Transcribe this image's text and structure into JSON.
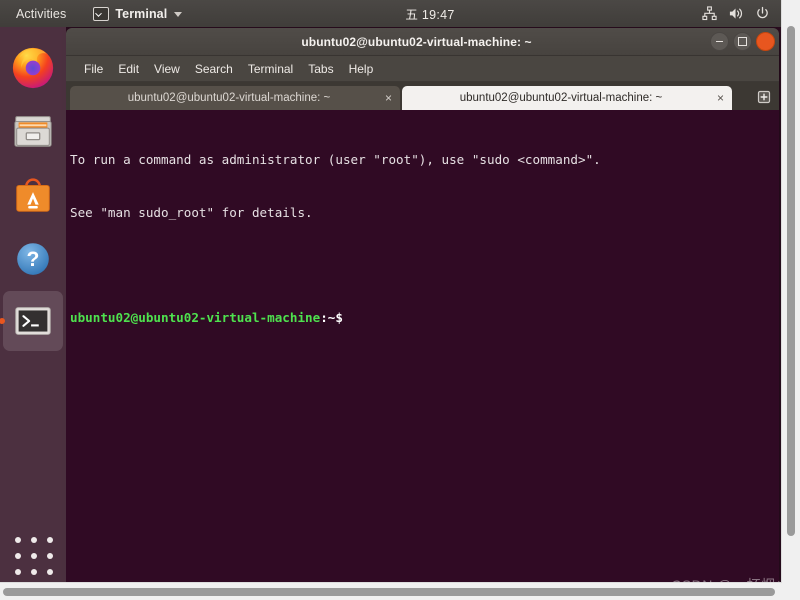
{
  "topbar": {
    "activities": "Activities",
    "app_icon": "terminal-icon",
    "app_name": "Terminal",
    "clock": "五 19:47",
    "tray": [
      {
        "name": "network-icon"
      },
      {
        "name": "volume-icon"
      },
      {
        "name": "power-icon"
      },
      {
        "name": "chevron-down-icon"
      }
    ]
  },
  "dock": {
    "items": [
      {
        "name": "firefox",
        "label": "Firefox",
        "active": false
      },
      {
        "name": "files",
        "label": "Files",
        "active": false
      },
      {
        "name": "ubuntu-software",
        "label": "Ubuntu Software",
        "active": false
      },
      {
        "name": "help",
        "label": "Help",
        "active": false
      },
      {
        "name": "terminal",
        "label": "Terminal",
        "active": true
      }
    ],
    "show_applications": "Show Applications"
  },
  "window": {
    "title": "ubuntu02@ubuntu02-virtual-machine: ~",
    "controls": {
      "minimize": "minimize",
      "maximize": "maximize",
      "close": "close"
    },
    "menu": [
      "File",
      "Edit",
      "View",
      "Search",
      "Terminal",
      "Tabs",
      "Help"
    ],
    "tabs": [
      {
        "label": "ubuntu02@ubuntu02-virtual-machine: ~",
        "active": false,
        "close": "×"
      },
      {
        "label": "ubuntu02@ubuntu02-virtual-machine: ~",
        "active": true,
        "close": "×"
      }
    ],
    "new_tab_label": "New Tab"
  },
  "terminal": {
    "background": "#300a24",
    "prompt_color": "#4ee24e",
    "lines": [
      {
        "type": "text",
        "text": "To run a command as administrator (user \"root\"), use \"sudo <command>\"."
      },
      {
        "type": "text",
        "text": "See \"man sudo_root\" for details."
      },
      {
        "type": "blank",
        "text": ""
      },
      {
        "type": "prompt",
        "user_host": "ubuntu02@ubuntu02-virtual-machine",
        "path": ":~$"
      }
    ]
  },
  "watermark": "CSDN @一杯烟火"
}
